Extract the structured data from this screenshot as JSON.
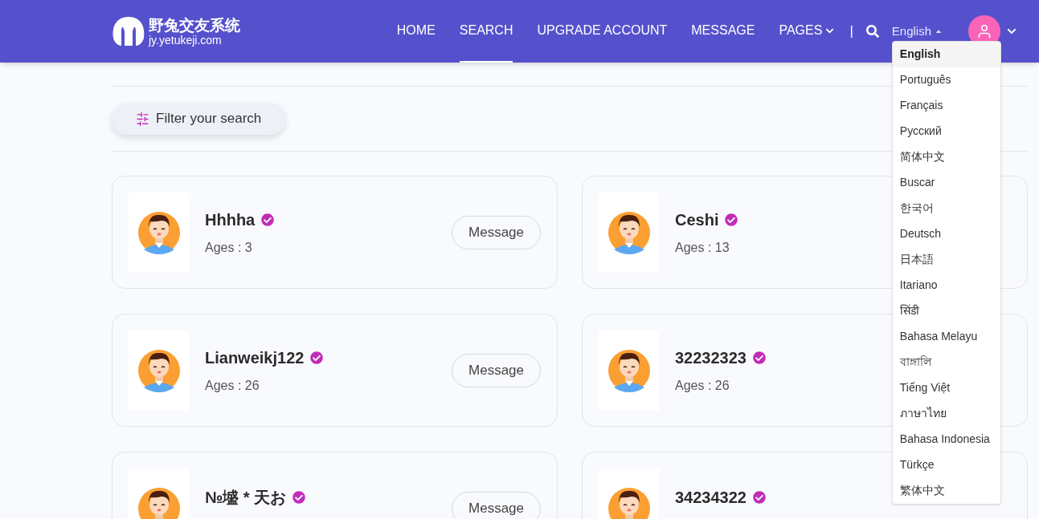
{
  "logo": {
    "title": "野兔交友系统",
    "subtitle": "jy.yetukeji.com"
  },
  "nav": [
    {
      "label": "HOME",
      "selected": false,
      "kind": "link"
    },
    {
      "label": "SEARCH",
      "selected": true,
      "kind": "link"
    },
    {
      "label": "UPGRADE ACCOUNT",
      "selected": false,
      "kind": "link"
    },
    {
      "label": "MESSAGE",
      "selected": false,
      "kind": "link"
    },
    {
      "label": "PAGES",
      "selected": false,
      "kind": "menu"
    }
  ],
  "separator": "|",
  "language": {
    "label": "English",
    "expanded": true,
    "options": [
      {
        "label": "English",
        "selected": true
      },
      {
        "label": "Português",
        "selected": false
      },
      {
        "label": "Français",
        "selected": false
      },
      {
        "label": "Русский",
        "selected": false
      },
      {
        "label": "简体中文",
        "selected": false
      },
      {
        "label": "Buscar",
        "selected": false
      },
      {
        "label": "한국어",
        "selected": false
      },
      {
        "label": "Deutsch",
        "selected": false
      },
      {
        "label": "日本語",
        "selected": false
      },
      {
        "label": "Itariano",
        "selected": false
      },
      {
        "label": "सिंडी",
        "selected": false
      },
      {
        "label": "Bahasa Melayu",
        "selected": false
      },
      {
        "label": "বাঙ্গালি",
        "selected": false
      },
      {
        "label": "Tiếng Việt",
        "selected": false
      },
      {
        "label": "ภาษาไทย",
        "selected": false
      },
      {
        "label": "Bahasa Indonesia",
        "selected": false
      },
      {
        "label": "Türkçe",
        "selected": false
      },
      {
        "label": "繁体中文",
        "selected": false
      }
    ]
  },
  "filter_button": "Filter your search",
  "members": [
    {
      "name": "Hhhha",
      "verified": true,
      "age": "Ages : 3",
      "message": "Message"
    },
    {
      "name": "Ceshi",
      "verified": true,
      "age": "Ages : 13"
    },
    {
      "name": "Lianweikj122",
      "verified": true,
      "age": "Ages : 26",
      "message": "Message"
    },
    {
      "name": "32232323",
      "verified": true,
      "age": "Ages : 26"
    },
    {
      "name": "№墭 * 天お",
      "verified": true,
      "message": "Message"
    },
    {
      "name": "34234322",
      "verified": true
    }
  ]
}
